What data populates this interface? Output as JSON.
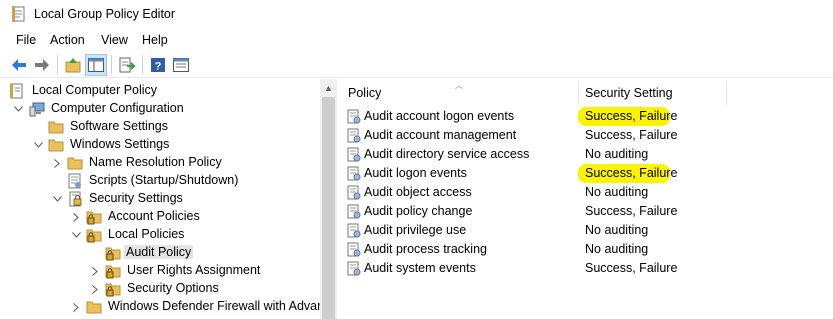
{
  "window": {
    "title": "Local Group Policy Editor"
  },
  "menu": {
    "items": [
      "File",
      "Action",
      "View",
      "Help"
    ]
  },
  "toolbar": {
    "buttons": [
      "back-arrow-icon",
      "forward-arrow-icon",
      "up-folder-icon",
      "show-hide-tree-icon",
      "export-list-icon",
      "help-icon",
      "properties-icon"
    ]
  },
  "tree": {
    "items": [
      {
        "label": "Local Computer Policy",
        "level": 0,
        "expander": "",
        "icon": "policy-root-icon"
      },
      {
        "label": "Computer Configuration",
        "level": 1,
        "expander": "open",
        "icon": "computer-icon"
      },
      {
        "label": "Software Settings",
        "level": 2,
        "expander": "",
        "icon": "folder-icon"
      },
      {
        "label": "Windows Settings",
        "level": 2,
        "expander": "open",
        "icon": "folder-icon"
      },
      {
        "label": "Name Resolution Policy",
        "level": 3,
        "expander": "closed",
        "icon": "folder-icon"
      },
      {
        "label": "Scripts (Startup/Shutdown)",
        "level": 3,
        "expander": "",
        "icon": "scripts-icon"
      },
      {
        "label": "Security Settings",
        "level": 3,
        "expander": "open",
        "icon": "security-settings-icon"
      },
      {
        "label": "Account Policies",
        "level": 4,
        "expander": "closed",
        "icon": "locked-folder-icon"
      },
      {
        "label": "Local Policies",
        "level": 4,
        "expander": "open",
        "icon": "locked-folder-icon"
      },
      {
        "label": "Audit Policy",
        "level": 5,
        "expander": "",
        "icon": "locked-folder-icon",
        "selected": true
      },
      {
        "label": "User Rights Assignment",
        "level": 5,
        "expander": "closed",
        "icon": "locked-folder-icon"
      },
      {
        "label": "Security Options",
        "level": 5,
        "expander": "closed",
        "icon": "locked-folder-icon"
      },
      {
        "label": "Windows Defender Firewall with Advanc",
        "level": 4,
        "expander": "closed",
        "icon": "folder-icon"
      }
    ]
  },
  "list": {
    "columns": [
      "Policy",
      "Security Setting"
    ],
    "rows": [
      {
        "policy": "Audit account logon events",
        "setting": "Success, Failure",
        "highlighted": true
      },
      {
        "policy": "Audit account management",
        "setting": "Success, Failure",
        "highlighted": false
      },
      {
        "policy": "Audit directory service access",
        "setting": "No auditing",
        "highlighted": false
      },
      {
        "policy": "Audit logon events",
        "setting": "Success, Failure",
        "highlighted": true
      },
      {
        "policy": "Audit object access",
        "setting": "No auditing",
        "highlighted": false
      },
      {
        "policy": "Audit policy change",
        "setting": "Success, Failure",
        "highlighted": false
      },
      {
        "policy": "Audit privilege use",
        "setting": "No auditing",
        "highlighted": false
      },
      {
        "policy": "Audit process tracking",
        "setting": "No auditing",
        "highlighted": false
      },
      {
        "policy": "Audit system events",
        "setting": "Success, Failure",
        "highlighted": false
      }
    ]
  },
  "colors": {
    "highlight": "#fbf300",
    "selection": "#e5e5e5",
    "folder": "#e8c15a"
  }
}
